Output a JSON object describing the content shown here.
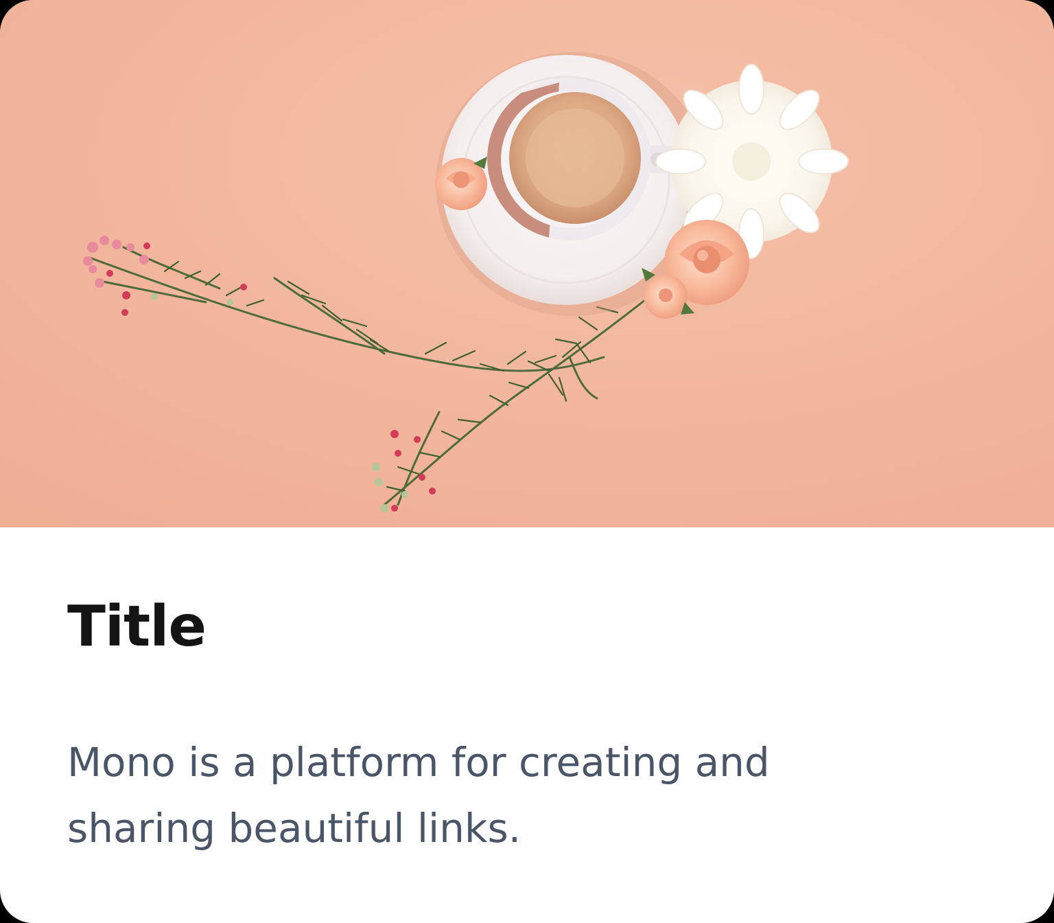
{
  "card": {
    "image_alt": "Coffee cup on a saucer with flowers on a peach background",
    "title": "Title",
    "description": "Mono is a platform for creating and sharing beautiful links."
  },
  "colors": {
    "background": "#f2b8a0",
    "card": "#ffffff",
    "title": "#141414",
    "description": "#4a5567"
  }
}
